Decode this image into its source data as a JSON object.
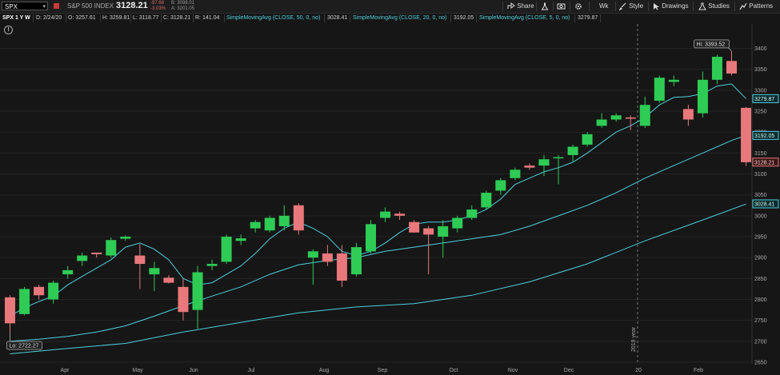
{
  "toolbar": {
    "symbol": "SPX",
    "index_name": "S&P 500 INDEX",
    "last_price": "3128.21",
    "change": "-97.68",
    "change_pct": "-3.03%",
    "bid": "B: 3098.01",
    "ask": "A: 3201.05",
    "share_label": "Share",
    "period_label": "Wk",
    "style_label": "Style",
    "drawings_label": "Drawings",
    "studies_label": "Studies",
    "patterns_label": "Patterns"
  },
  "info": {
    "symbol": "SPX 1 Y W",
    "date": "D: 2/24/20",
    "open": "O: 3257.61",
    "high": "H: 3259.81",
    "low": "L: 3118.77",
    "close": "C: 3128.21",
    "range": "R: 141.04",
    "sma50_label": "SimpleMovingAvg (CLOSE, 50, 0, no)",
    "sma50_value": "3028.41",
    "sma20_label": "SimpleMovingAvg (CLOSE, 20, 0, no)",
    "sma20_value": "3192.05",
    "sma5_label": "SimpleMovingAvg (CLOSE, 5, 0, no)",
    "sma5_value": "3279.87"
  },
  "colors": {
    "up": "#2ecc55",
    "down": "#e8787b",
    "sma": "#4fd0dd",
    "background": "#161616",
    "grid": "#242424"
  },
  "chart_data": {
    "type": "candlestick",
    "ylim": [
      2650,
      3450
    ],
    "y_ticks": [
      2650,
      2700,
      2750,
      2800,
      2850,
      2900,
      2950,
      3000,
      3050,
      3100,
      3150,
      3200,
      3250,
      3300,
      3350,
      3400
    ],
    "x_labels": [
      "Apr",
      "May",
      "Jun",
      "Jul",
      "Aug",
      "Sep",
      "Oct",
      "Nov",
      "Dec",
      "20",
      "Feb"
    ],
    "year_marker": "2019 year",
    "hi_label": "Hi: 3393.52",
    "lo_label": "Lo: 2722.27",
    "last_tag": "3128.21",
    "sma5_tag": "3279.87",
    "sma20_tag": "3192.05",
    "sma50_tag": "3028.41",
    "candles": [
      {
        "o": 2805,
        "h": 2810,
        "l": 2722,
        "c": 2743
      },
      {
        "o": 2765,
        "h": 2830,
        "l": 2762,
        "c": 2825
      },
      {
        "o": 2830,
        "h": 2835,
        "l": 2800,
        "c": 2810
      },
      {
        "o": 2800,
        "h": 2845,
        "l": 2790,
        "c": 2840
      },
      {
        "o": 2860,
        "h": 2880,
        "l": 2850,
        "c": 2870
      },
      {
        "o": 2892,
        "h": 2912,
        "l": 2880,
        "c": 2905
      },
      {
        "o": 2912,
        "h": 2912,
        "l": 2900,
        "c": 2908
      },
      {
        "o": 2905,
        "h": 2948,
        "l": 2900,
        "c": 2942
      },
      {
        "o": 2945,
        "h": 2953,
        "l": 2940,
        "c": 2950
      },
      {
        "o": 2905,
        "h": 2932,
        "l": 2825,
        "c": 2885
      },
      {
        "o": 2860,
        "h": 2890,
        "l": 2820,
        "c": 2875
      },
      {
        "o": 2852,
        "h": 2858,
        "l": 2838,
        "c": 2840
      },
      {
        "o": 2830,
        "h": 2850,
        "l": 2750,
        "c": 2770
      },
      {
        "o": 2775,
        "h": 2880,
        "l": 2730,
        "c": 2865
      },
      {
        "o": 2880,
        "h": 2895,
        "l": 2870,
        "c": 2885
      },
      {
        "o": 2890,
        "h": 2955,
        "l": 2885,
        "c": 2950
      },
      {
        "o": 2940,
        "h": 2955,
        "l": 2930,
        "c": 2946
      },
      {
        "o": 2970,
        "h": 2990,
        "l": 2960,
        "c": 2985
      },
      {
        "o": 2965,
        "h": 3000,
        "l": 2960,
        "c": 2995
      },
      {
        "o": 2975,
        "h": 3025,
        "l": 2965,
        "c": 3000
      },
      {
        "o": 3025,
        "h": 3030,
        "l": 2955,
        "c": 2965
      },
      {
        "o": 2900,
        "h": 2920,
        "l": 2835,
        "c": 2915
      },
      {
        "o": 2910,
        "h": 2930,
        "l": 2880,
        "c": 2890
      },
      {
        "o": 2910,
        "h": 2930,
        "l": 2830,
        "c": 2845
      },
      {
        "o": 2860,
        "h": 2935,
        "l": 2855,
        "c": 2925
      },
      {
        "o": 2915,
        "h": 2990,
        "l": 2910,
        "c": 2980
      },
      {
        "o": 2995,
        "h": 3020,
        "l": 2985,
        "c": 3010
      },
      {
        "o": 3005,
        "h": 3010,
        "l": 2990,
        "c": 3000
      },
      {
        "o": 2985,
        "h": 2990,
        "l": 2960,
        "c": 2960
      },
      {
        "o": 2970,
        "h": 2975,
        "l": 2860,
        "c": 2955
      },
      {
        "o": 2950,
        "h": 2990,
        "l": 2900,
        "c": 2975
      },
      {
        "o": 2970,
        "h": 3000,
        "l": 2960,
        "c": 2995
      },
      {
        "o": 2995,
        "h": 3025,
        "l": 2990,
        "c": 3015
      },
      {
        "o": 3020,
        "h": 3060,
        "l": 3015,
        "c": 3055
      },
      {
        "o": 3060,
        "h": 3090,
        "l": 3050,
        "c": 3085
      },
      {
        "o": 3090,
        "h": 3115,
        "l": 3085,
        "c": 3110
      },
      {
        "o": 3120,
        "h": 3125,
        "l": 3110,
        "c": 3115
      },
      {
        "o": 3120,
        "h": 3145,
        "l": 3095,
        "c": 3135
      },
      {
        "o": 3140,
        "h": 3145,
        "l": 3075,
        "c": 3140
      },
      {
        "o": 3145,
        "h": 3170,
        "l": 3130,
        "c": 3165
      },
      {
        "o": 3170,
        "h": 3200,
        "l": 3165,
        "c": 3195
      },
      {
        "o": 3215,
        "h": 3245,
        "l": 3210,
        "c": 3230
      },
      {
        "o": 3230,
        "h": 3245,
        "l": 3225,
        "c": 3240
      },
      {
        "o": 3235,
        "h": 3240,
        "l": 3205,
        "c": 3232
      },
      {
        "o": 3215,
        "h": 3285,
        "l": 3210,
        "c": 3265
      },
      {
        "o": 3275,
        "h": 3335,
        "l": 3270,
        "c": 3330
      },
      {
        "o": 3320,
        "h": 3335,
        "l": 3310,
        "c": 3325
      },
      {
        "o": 3255,
        "h": 3265,
        "l": 3215,
        "c": 3230
      },
      {
        "o": 3245,
        "h": 3345,
        "l": 3235,
        "c": 3325
      },
      {
        "o": 3325,
        "h": 3385,
        "l": 3315,
        "c": 3380
      },
      {
        "o": 3370,
        "h": 3393,
        "l": 3335,
        "c": 3340
      },
      {
        "o": 3258,
        "h": 3260,
        "l": 3119,
        "c": 3128
      }
    ],
    "sma5": [
      [
        0,
        2760
      ],
      [
        1,
        2780
      ],
      [
        2,
        2795
      ],
      [
        3,
        2808
      ],
      [
        4,
        2835
      ],
      [
        5,
        2855
      ],
      [
        6,
        2875
      ],
      [
        7,
        2895
      ],
      [
        8,
        2925
      ],
      [
        9,
        2935
      ],
      [
        10,
        2920
      ],
      [
        11,
        2895
      ],
      [
        12,
        2850
      ],
      [
        13,
        2835
      ],
      [
        14,
        2840
      ],
      [
        15,
        2860
      ],
      [
        16,
        2880
      ],
      [
        17,
        2910
      ],
      [
        18,
        2945
      ],
      [
        19,
        2970
      ],
      [
        20,
        2985
      ],
      [
        21,
        2970
      ],
      [
        22,
        2950
      ],
      [
        23,
        2915
      ],
      [
        24,
        2905
      ],
      [
        25,
        2915
      ],
      [
        26,
        2935
      ],
      [
        27,
        2960
      ],
      [
        28,
        2980
      ],
      [
        29,
        2985
      ],
      [
        30,
        2985
      ],
      [
        31,
        2990
      ],
      [
        32,
        3000
      ],
      [
        33,
        3015
      ],
      [
        34,
        3040
      ],
      [
        35,
        3075
      ],
      [
        36,
        3090
      ],
      [
        37,
        3105
      ],
      [
        38,
        3115
      ],
      [
        39,
        3128
      ],
      [
        40,
        3150
      ],
      [
        41,
        3175
      ],
      [
        42,
        3200
      ],
      [
        43,
        3215
      ],
      [
        44,
        3235
      ],
      [
        45,
        3265
      ],
      [
        46,
        3283
      ],
      [
        47,
        3285
      ],
      [
        48,
        3292
      ],
      [
        49,
        3310
      ],
      [
        50,
        3315
      ],
      [
        51,
        3280
      ]
    ],
    "sma20": [
      [
        0,
        2700
      ],
      [
        2,
        2705
      ],
      [
        4,
        2712
      ],
      [
        6,
        2722
      ],
      [
        8,
        2737
      ],
      [
        10,
        2760
      ],
      [
        12,
        2785
      ],
      [
        14,
        2808
      ],
      [
        16,
        2830
      ],
      [
        18,
        2860
      ],
      [
        20,
        2883
      ],
      [
        22,
        2893
      ],
      [
        24,
        2900
      ],
      [
        26,
        2915
      ],
      [
        28,
        2925
      ],
      [
        30,
        2935
      ],
      [
        32,
        2945
      ],
      [
        34,
        2955
      ],
      [
        36,
        2975
      ],
      [
        38,
        3000
      ],
      [
        40,
        3025
      ],
      [
        42,
        3055
      ],
      [
        44,
        3090
      ],
      [
        46,
        3120
      ],
      [
        48,
        3150
      ],
      [
        50,
        3180
      ],
      [
        51,
        3192
      ]
    ],
    "sma50": [
      [
        0,
        2670
      ],
      [
        4,
        2683
      ],
      [
        8,
        2695
      ],
      [
        12,
        2722
      ],
      [
        16,
        2745
      ],
      [
        20,
        2768
      ],
      [
        24,
        2782
      ],
      [
        28,
        2790
      ],
      [
        32,
        2810
      ],
      [
        36,
        2842
      ],
      [
        40,
        2885
      ],
      [
        44,
        2940
      ],
      [
        48,
        2990
      ],
      [
        51,
        3028
      ]
    ]
  }
}
